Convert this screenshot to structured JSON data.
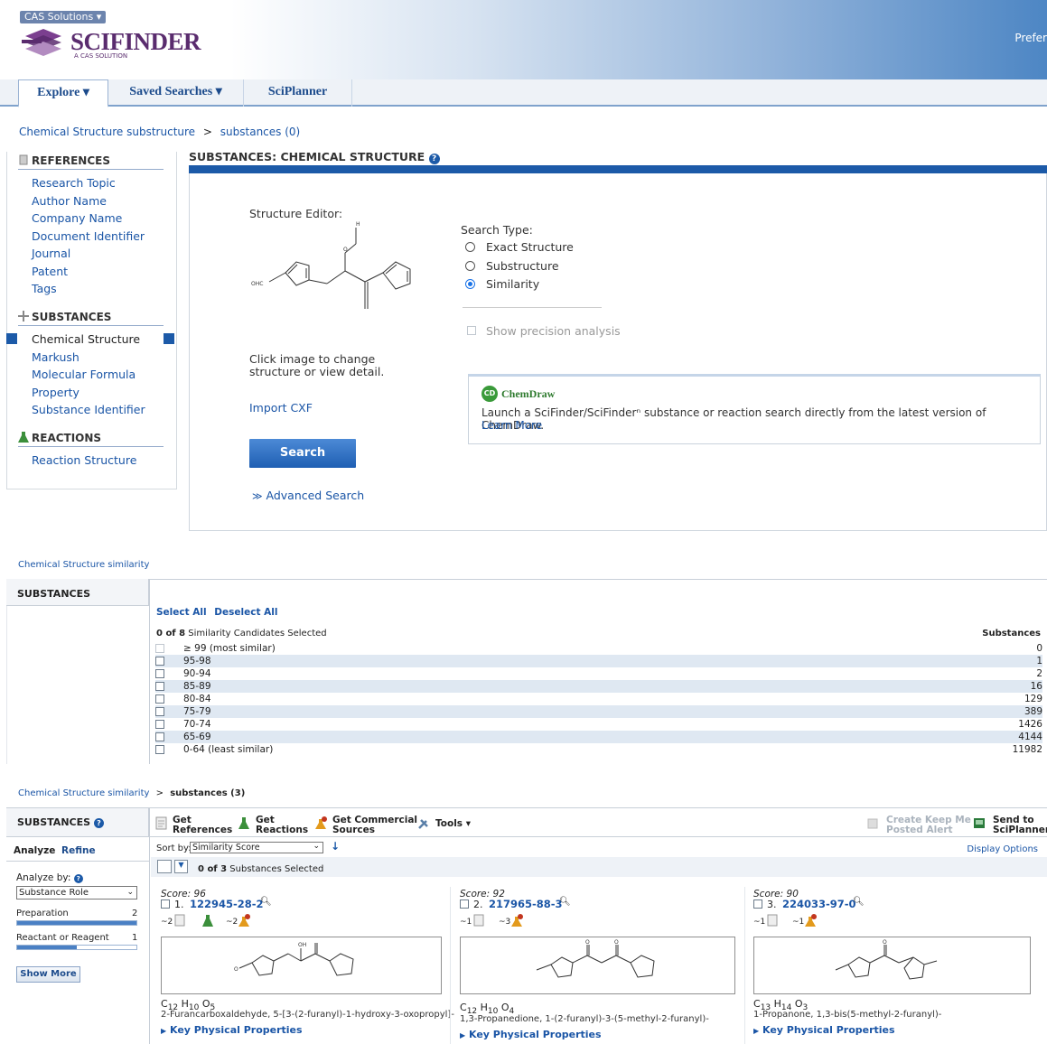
{
  "header": {
    "cas_solutions": "CAS Solutions ▾",
    "logo": "SCIFINDER",
    "logo_sub": "A CAS SOLUTION",
    "preferences": "Prefer"
  },
  "nav": {
    "tabs": [
      {
        "label": "Explore ▾"
      },
      {
        "label": "Saved Searches ▾"
      },
      {
        "label": "SciPlanner"
      }
    ]
  },
  "breadcrumb1": {
    "part1": "Chemical Structure substructure",
    "sep": ">",
    "part2": "substances (0)"
  },
  "sidebar": {
    "references_head": "REFERENCES",
    "references": [
      "Research Topic",
      "Author Name",
      "Company Name",
      "Document Identifier",
      "Journal",
      "Patent",
      "Tags"
    ],
    "substances_head": "SUBSTANCES",
    "substances": [
      "Chemical Structure",
      "Markush",
      "Molecular Formula",
      "Property",
      "Substance Identifier"
    ],
    "reactions_head": "REACTIONS",
    "reactions": [
      "Reaction Structure"
    ]
  },
  "main": {
    "title": "SUBSTANCES: CHEMICAL STRUCTURE",
    "structure_editor": "Structure Editor:",
    "struct_label_ohc": "OHC",
    "struct_label_h": "H",
    "struct_label_o": "O",
    "click_hint": "Click image to change structure or view detail.",
    "import_cxf": "Import CXF",
    "search_button": "Search",
    "advanced_search": "Advanced Search",
    "search_type_label": "Search Type:",
    "search_types": [
      "Exact Structure",
      "Substructure",
      "Similarity"
    ],
    "selected_type": "Similarity",
    "show_precision": "Show precision analysis",
    "chemdraw": {
      "brand": "ChemDraw",
      "text": "Launch a SciFinder/SciFinderⁿ substance or reaction search directly from the latest version of ChemDraw.",
      "learn_more": "Learn More"
    }
  },
  "similarity": {
    "breadcrumb": "Chemical Structure similarity",
    "section": "SUBSTANCES",
    "select_all": "Select All",
    "deselect_all": "Deselect All",
    "selected_count": "0 of 8",
    "selected_label": "Similarity Candidates Selected",
    "col_substances": "Substances",
    "rows": [
      {
        "range": "≥ 99 (most similar)",
        "count": "0",
        "disabled": true
      },
      {
        "range": "95-98",
        "count": "1"
      },
      {
        "range": "90-94",
        "count": "2"
      },
      {
        "range": "85-89",
        "count": "16"
      },
      {
        "range": "80-84",
        "count": "129"
      },
      {
        "range": "75-79",
        "count": "389"
      },
      {
        "range": "70-74",
        "count": "1426"
      },
      {
        "range": "65-69",
        "count": "4144"
      },
      {
        "range": "0-64 (least similar)",
        "count": "11982"
      }
    ]
  },
  "results": {
    "breadcrumb_a": "Chemical Structure similarity",
    "breadcrumb_sep": ">",
    "breadcrumb_b": "substances (3)",
    "section": "SUBSTANCES",
    "toolbar": {
      "get_references": [
        "Get",
        "References"
      ],
      "get_reactions": [
        "Get",
        "Reactions"
      ],
      "get_commercial": [
        "Get Commercial",
        "Sources"
      ],
      "tools": "Tools ▾",
      "keep_me_posted": [
        "Create Keep Me",
        "Posted Alert"
      ],
      "send_to": [
        "Send to",
        "SciPlanner"
      ]
    },
    "tab_analyze": "Analyze",
    "tab_refine": "Refine",
    "sort_label": "Sort by:",
    "sort_value": "Similarity Score",
    "display_options": "Display Options",
    "selected_count": "0 of 3",
    "selected_label": "Substances Selected",
    "analyze_by": "Analyze by:",
    "analyze_value": "Substance Role",
    "roles": [
      {
        "label": "Preparation",
        "count": "2",
        "fill": 1.0
      },
      {
        "label": "Reactant or Reagent",
        "count": "1",
        "fill": 0.5
      }
    ],
    "show_more": "Show More",
    "cards": [
      {
        "score_label": "Score:",
        "score": "96",
        "num": "1.",
        "rn": "122945-28-2",
        "icons": [
          "~2",
          "",
          "~2"
        ],
        "struct_oh": "OH",
        "struct_o": "O",
        "formula": {
          "c": "12",
          "h": "10",
          "o": "5"
        },
        "name": "2-Furancarboxaldehyde, 5-[3-(2-furanyl)-1-hydroxy-3-oxopropyl]-",
        "kpp": "Key Physical Properties"
      },
      {
        "score_label": "Score:",
        "score": "92",
        "num": "2.",
        "rn": "217965-88-3",
        "icons": [
          "~1",
          "~3"
        ],
        "struct_o1": "O",
        "struct_o2": "O",
        "formula": {
          "c": "12",
          "h": "10",
          "o": "4"
        },
        "name": "1,3-Propanedione, 1-(2-furanyl)-3-(5-methyl-2-furanyl)-",
        "kpp": "Key Physical Properties"
      },
      {
        "score_label": "Score:",
        "score": "90",
        "num": "3.",
        "rn": "224033-97-0",
        "icons": [
          "~1",
          "~1"
        ],
        "struct_o": "O",
        "formula": {
          "c": "13",
          "h": "14",
          "o": "3"
        },
        "name": "1-Propanone, 1,3-bis(5-methyl-2-furanyl)-",
        "kpp": "Key Physical Properties"
      }
    ]
  }
}
